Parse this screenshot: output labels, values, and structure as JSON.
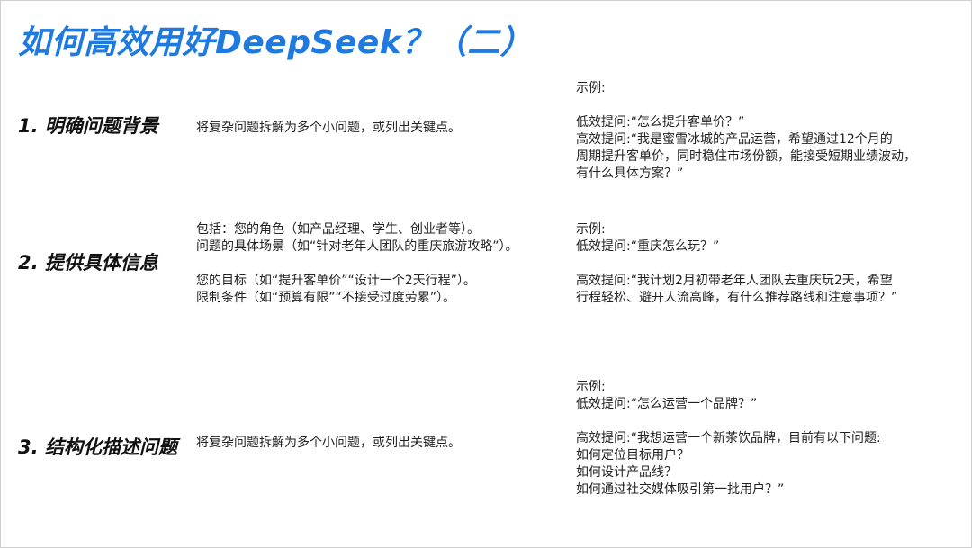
{
  "title": "如何高效用好DeepSeek？（二）",
  "sections": [
    {
      "heading": "1. 明确问题背景",
      "description": [
        "将复杂问题拆解为多个小问题，或列出关键点。"
      ],
      "example": [
        "示例:",
        "",
        "低效提问:“怎么提升客单价？”",
        "高效提问:“我是蜜雪冰城的产品运营，希望通过12个月的",
        "周期提升客单价，同时稳住市场份额，能接受短期业绩波动，",
        "有什么具体方案？”"
      ]
    },
    {
      "heading": "2. 提供具体信息",
      "description": [
        "包括：您的角色（如产品经理、学生、创业者等）。",
        "问题的具体场景（如“针对老年人团队的重庆旅游攻略”）。",
        "",
        "您的目标（如“提升客单价”“设计一个2天行程”）。",
        "限制条件（如“预算有限”“不接受过度劳累”）。"
      ],
      "example": [
        "示例:",
        "低效提问:“重庆怎么玩？”",
        "",
        "高效提问:“我计划2月初带老年人团队去重庆玩2天，希望",
        "行程轻松、避开人流高峰，有什么推荐路线和注意事项？”"
      ]
    },
    {
      "heading": "3. 结构化描述问题",
      "description": [
        "将复杂问题拆解为多个小问题，或列出关键点。"
      ],
      "example": [
        "示例:",
        "低效提问:“怎么运营一个品牌？”",
        "",
        "高效提问:“我想运营一个新茶饮品牌，目前有以下问题:",
        "如何定位目标用户？",
        "如何设计产品线？",
        "如何通过社交媒体吸引第一批用户？”"
      ]
    }
  ]
}
